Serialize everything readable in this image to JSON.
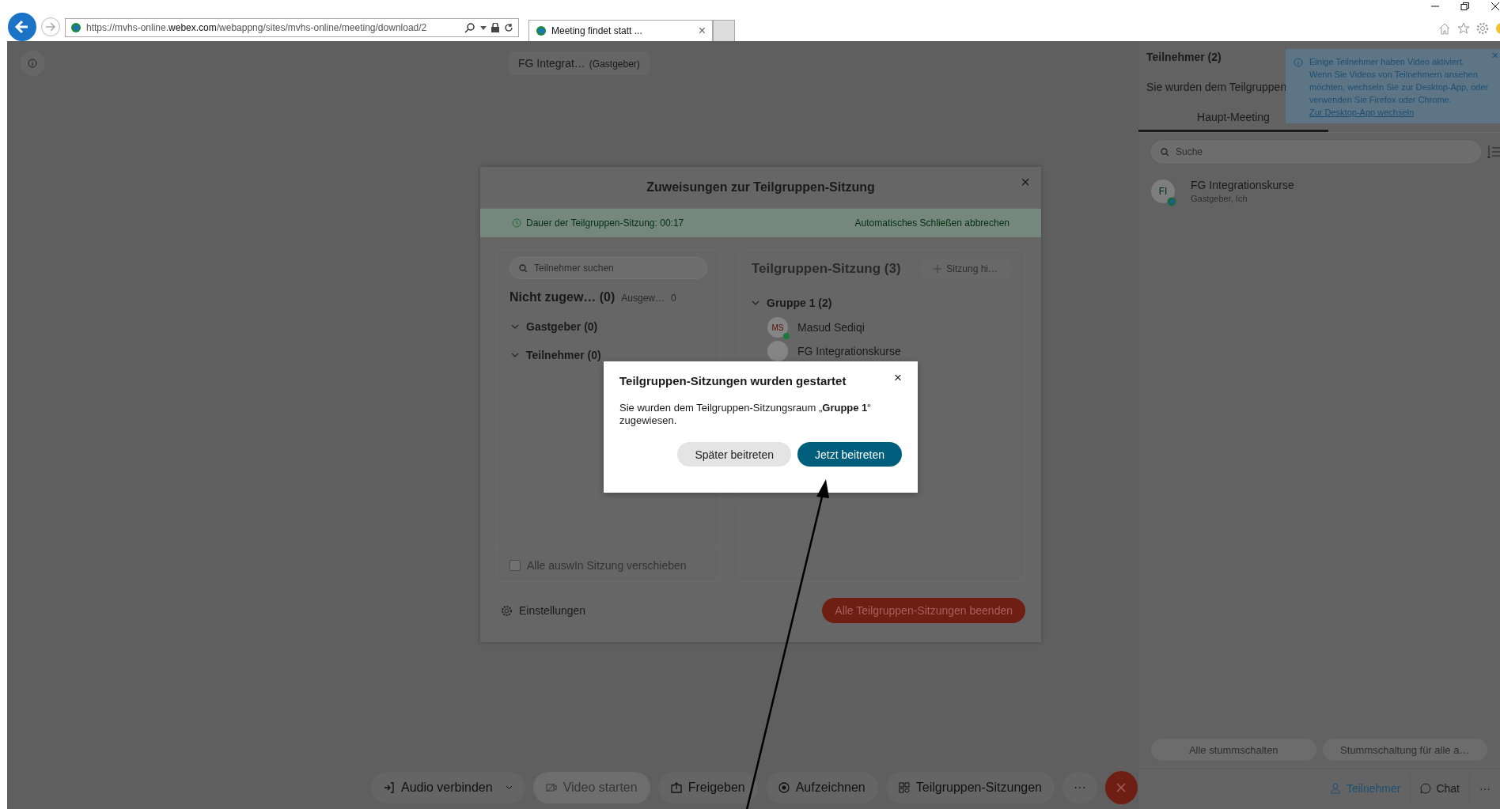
{
  "browser": {
    "address": "https://mvhs-online.**webex.com**/webappng/sites/mvhs-online/meeting/download/2",
    "tab_title": "Meeting findet statt ...",
    "tab_close": "×"
  },
  "meeting": {
    "host_name": "FG Integrat…",
    "host_role": "(Gastgeber)"
  },
  "breakout_dialog": {
    "title": "Zuweisungen zur Teilgruppen-Sitzung",
    "close": "×",
    "duration": "Dauer der Teilgruppen-Sitzung: 00:17",
    "cancel_auto_close": "Automatisches Schließen abbrechen",
    "search": {
      "placeholder": "Teilnehmer suchen"
    },
    "unassigned": "Nicht zugew… (0)",
    "selected_label": "Ausgew…",
    "selected_count": "0",
    "categories": [
      {
        "label": "Gastgeber (0)",
        "expanded": true
      },
      {
        "label": "Teilnehmer (0)",
        "expanded": true
      }
    ],
    "move_all": {
      "label": "Alle auswIn Sitzung verschieben",
      "checked": false
    },
    "sessions_title": "Teilgruppen-Sitzung (3)",
    "add_session": "Sitzung hi…",
    "sessions": [
      {
        "name": "Gruppe 1 (2)",
        "expanded": true,
        "members": [
          {
            "initials": "MS",
            "name": "Masud Sediqi",
            "online": true
          },
          {
            "name": "FG Integrationskurse",
            "online": false
          }
        ]
      }
    ],
    "settings": "Einstellungen",
    "end_all": "Alle Teilgruppen-Sitzungen beenden"
  },
  "popup": {
    "title": "Teilgruppen-Sitzungen wurden gestartet",
    "close": "×",
    "message": "Sie wurden dem Teilgruppen-Sitzungsraum „**Gruppe 1**“ zugewiesen.",
    "buttons": [
      {
        "label": "Später beitreten",
        "kind": "secondary"
      },
      {
        "label": "Jetzt beitreten",
        "kind": "primary"
      }
    ]
  },
  "toolbar": [
    {
      "label": "Audio verbinden",
      "disabled": false,
      "dropdown": true
    },
    {
      "label": "Video starten",
      "disabled": true,
      "dropdown": false
    },
    {
      "label": "Freigeben",
      "disabled": false,
      "dropdown": false
    },
    {
      "label": "Aufzeichnen",
      "disabled": false,
      "dropdown": false
    },
    {
      "label": "Teilgruppen-Sitzungen",
      "disabled": false,
      "dropdown": false
    }
  ],
  "toolbar_more": "···",
  "panel": {
    "title": "Teilnehmer (2)",
    "notice": "Sie wurden dem Teilgruppen",
    "tabs": [
      {
        "label": "Haupt-Meeting",
        "selected": true
      }
    ],
    "search": {
      "placeholder": "Suche"
    },
    "participants": [
      {
        "initials": "FI",
        "name": "FG Integrationskurse",
        "role": "Gastgeber, Ich"
      }
    ],
    "tooltip": {
      "text": "Einige Teilnehmer haben Video aktiviert. Wenn Sie Videos von Teilnehmern ansehen möchten, wechseln Sie zur Desktop-App, oder verwenden Sie Firefox oder Chrome.",
      "link": "Zur Desktop-App wechseln",
      "close": "×"
    },
    "actions": [
      "Alle stummschalten",
      "Stummschaltung für alle a…"
    ],
    "bottom_tabs": [
      {
        "label": "Teilnehmer",
        "selected": true
      },
      {
        "label": "Chat",
        "selected": false
      }
    ],
    "more": "···"
  }
}
